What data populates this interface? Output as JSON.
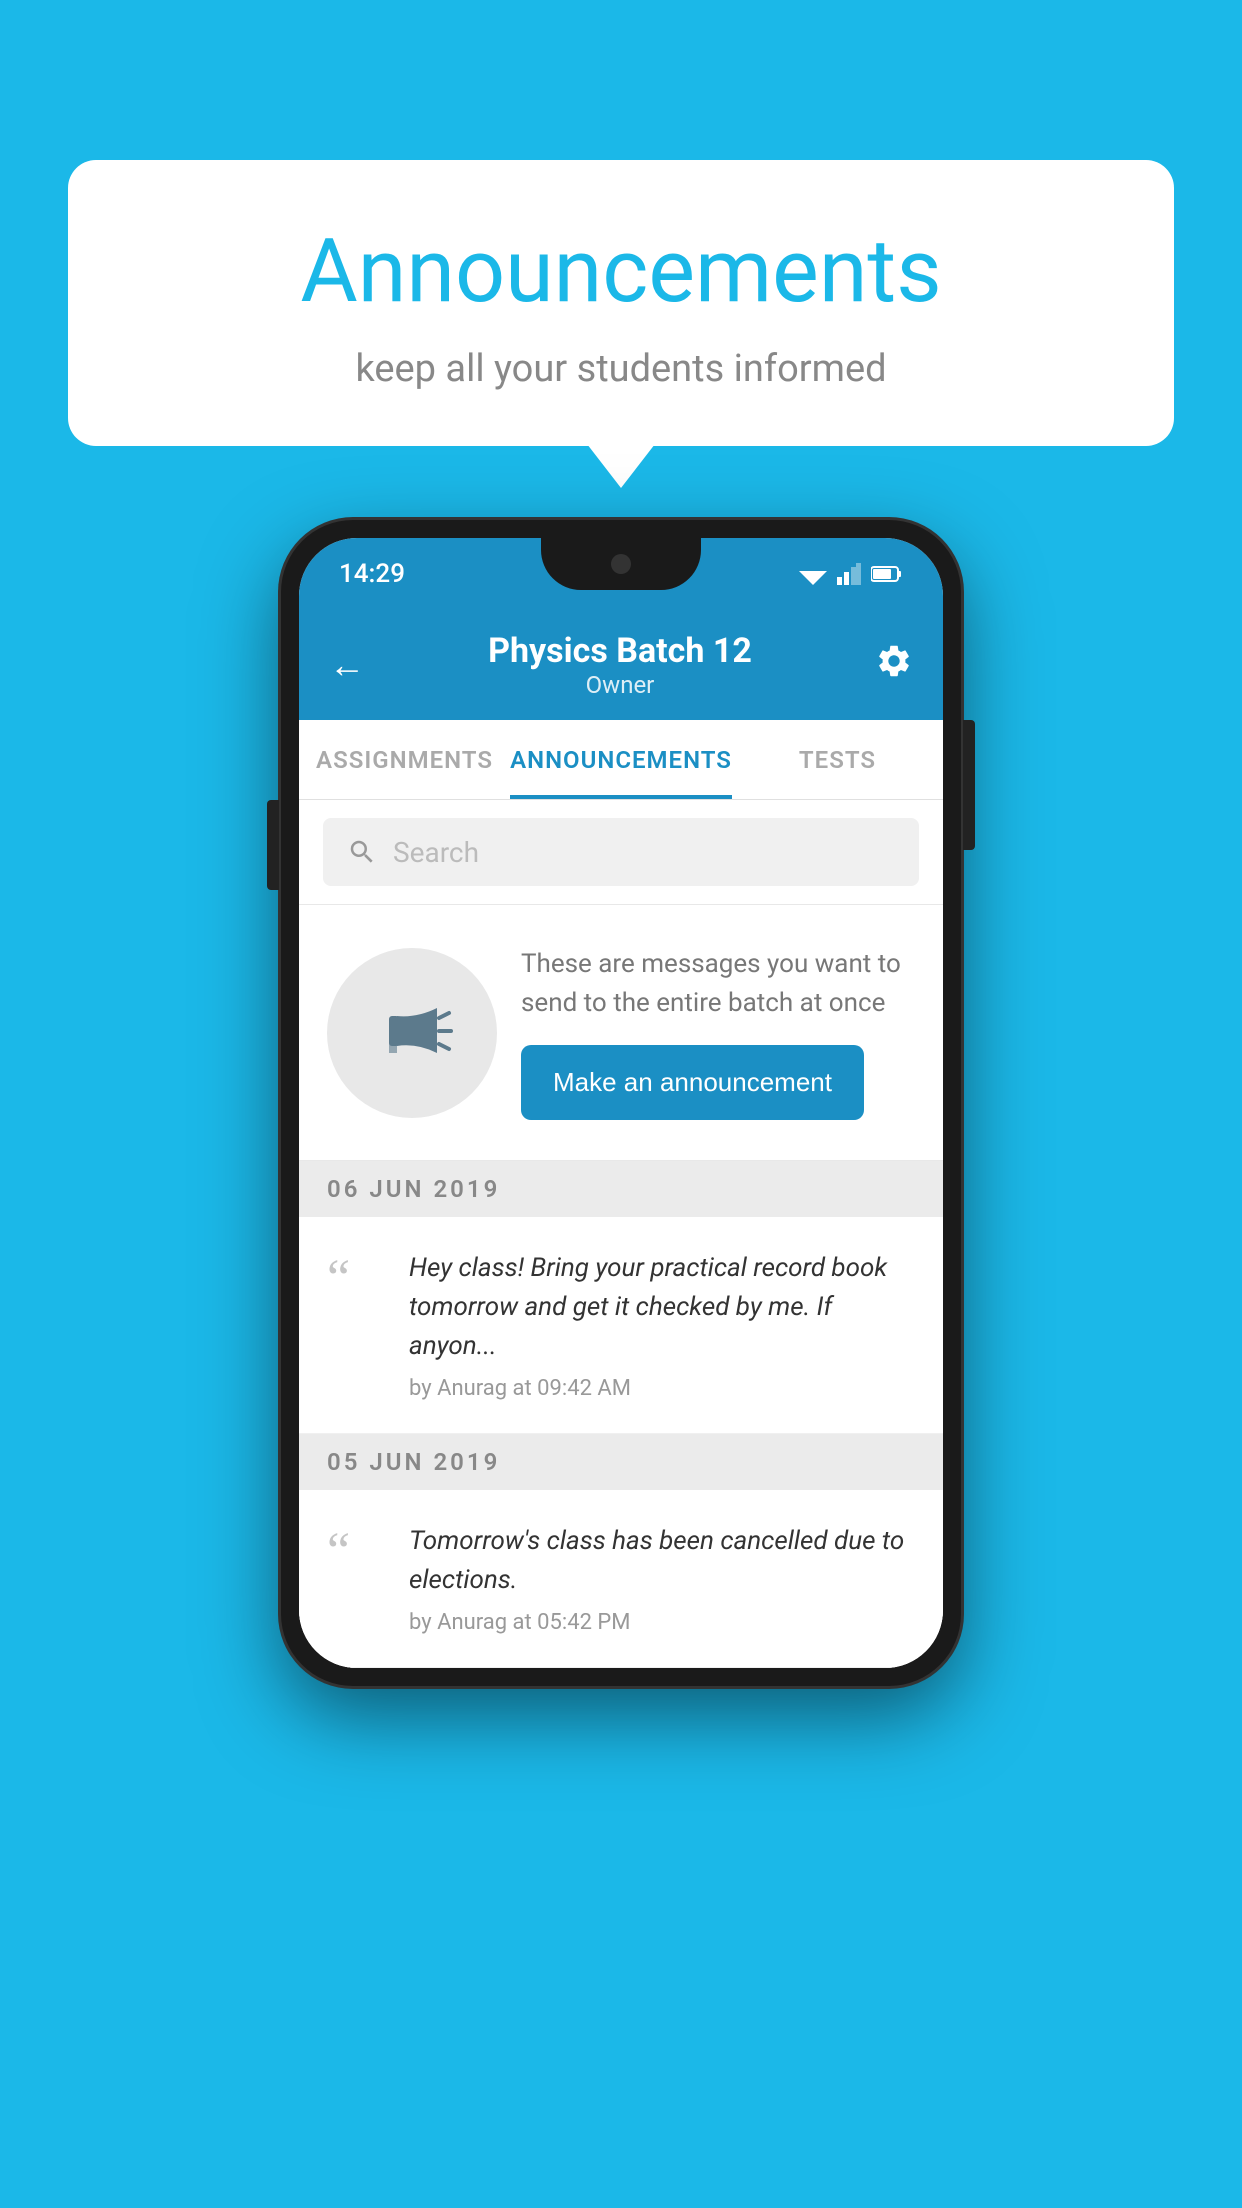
{
  "bubble": {
    "title": "Announcements",
    "subtitle": "keep all your students informed"
  },
  "statusBar": {
    "time": "14:29"
  },
  "appBar": {
    "batchName": "Physics Batch 12",
    "role": "Owner",
    "backLabel": "←"
  },
  "tabs": [
    {
      "label": "ASSIGNMENTS",
      "active": false
    },
    {
      "label": "ANNOUNCEMENTS",
      "active": true
    },
    {
      "label": "TESTS",
      "active": false
    }
  ],
  "search": {
    "placeholder": "Search"
  },
  "promo": {
    "description": "These are messages you want to send to the entire batch at once",
    "buttonLabel": "Make an announcement"
  },
  "announcements": [
    {
      "date": "06  JUN  2019",
      "text": "Hey class! Bring your practical record book tomorrow and get it checked by me. If anyon...",
      "meta": "by Anurag at 09:42 AM"
    },
    {
      "date": "05  JUN  2019",
      "text": "Tomorrow's class has been cancelled due to elections.",
      "meta": "by Anurag at 05:42 PM"
    }
  ],
  "colors": {
    "accent": "#1b8fc4",
    "background": "#1bb8e8"
  }
}
